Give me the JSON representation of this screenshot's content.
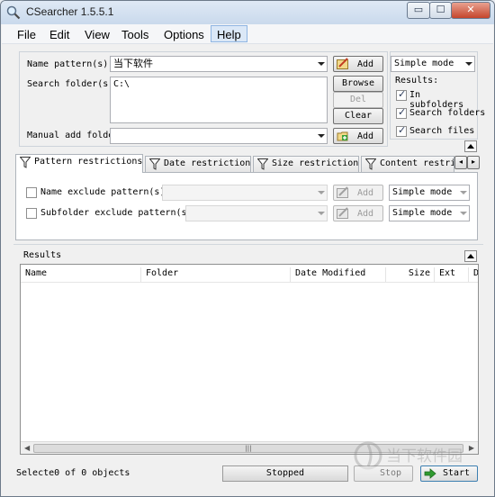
{
  "window": {
    "title": "CSearcher 1.5.5.1",
    "min_glyph": "▭",
    "max_glyph": "☐",
    "close_glyph": "✕"
  },
  "menu": [
    "File",
    "Edit",
    "View",
    "Tools",
    "Options",
    "Help"
  ],
  "search": {
    "name_pattern_label": "Name pattern(s):",
    "name_pattern_value": "当下软件",
    "search_folder_label": "Search folder(s):",
    "search_folder_value": "C:\\",
    "manual_add_label": "Manual add folder",
    "manual_add_value": "",
    "buttons": {
      "add_top": "Add",
      "browse": "Browse",
      "del": "Del",
      "clear": "Clear",
      "add_bottom": "Add"
    },
    "mode": "Simple mode",
    "results_label": "Results:",
    "options": [
      {
        "label": "In subfolders",
        "checked": true
      },
      {
        "label": "Search folders",
        "checked": true
      },
      {
        "label": "Search files",
        "checked": true
      }
    ]
  },
  "tabs": [
    {
      "label": "Pattern restrictions",
      "active": true
    },
    {
      "label": "Date restrictions",
      "active": false
    },
    {
      "label": "Size restrictions",
      "active": false
    },
    {
      "label": "Content restrictions",
      "active": false
    }
  ],
  "pattern_restrictions": {
    "name_exclude": {
      "label": "Name exclude pattern(s):",
      "checked": false,
      "value": "",
      "add": "Add",
      "mode": "Simple mode"
    },
    "subfolder_exclude": {
      "label": "Subfolder exclude pattern(s):",
      "checked": false,
      "value": "",
      "add": "Add",
      "mode": "Simple mode"
    }
  },
  "results": {
    "title": "Results",
    "columns": [
      "Name",
      "Folder",
      "Date Modified",
      "Size",
      "Ext",
      "D"
    ],
    "rows": []
  },
  "status": {
    "selected_text": "Selecte0 of 0 objects",
    "progress_text": "Stopped",
    "stop_label": "Stop",
    "start_label": "Start"
  },
  "watermark": {
    "text": "当下软件园"
  }
}
